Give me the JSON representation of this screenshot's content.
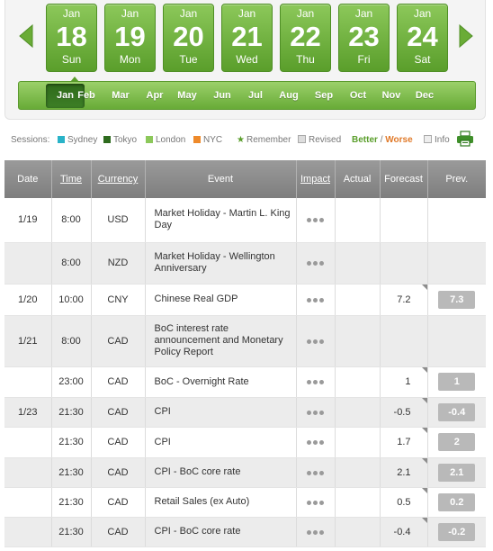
{
  "calendar": {
    "prev_label": "previous week",
    "next_label": "next week",
    "days": [
      {
        "month": "Jan",
        "day": "18",
        "weekday": "Sun"
      },
      {
        "month": "Jan",
        "day": "19",
        "weekday": "Mon"
      },
      {
        "month": "Jan",
        "day": "20",
        "weekday": "Tue"
      },
      {
        "month": "Jan",
        "day": "21",
        "weekday": "Wed"
      },
      {
        "month": "Jan",
        "day": "22",
        "weekday": "Thu"
      },
      {
        "month": "Jan",
        "day": "23",
        "weekday": "Fri"
      },
      {
        "month": "Jan",
        "day": "24",
        "weekday": "Sat"
      }
    ],
    "months": [
      "Jan",
      "Feb",
      "Mar",
      "Apr",
      "May",
      "Jun",
      "Jul",
      "Aug",
      "Sep",
      "Oct",
      "Nov",
      "Dec"
    ],
    "active_month": "Jan",
    "accent_color": "#6aac36"
  },
  "legend": {
    "sessions_label": "Sessions:",
    "sessions": [
      {
        "name": "Sydney",
        "color": "#29b3c8"
      },
      {
        "name": "Tokyo",
        "color": "#2e6b1e"
      },
      {
        "name": "London",
        "color": "#8cc85a"
      },
      {
        "name": "NYC",
        "color": "#ee8a2b"
      }
    ],
    "remember": "Remember",
    "revised": "Revised",
    "better": "Better",
    "separator": "/",
    "worse": "Worse",
    "info": "Info",
    "better_color": "#5a9e2b",
    "worse_color": "#e07a2a",
    "print_icon": "printer-icon"
  },
  "table": {
    "headers": {
      "date": "Date",
      "time": "Time",
      "currency": "Currency",
      "event": "Event",
      "impact": "Impact",
      "actual": "Actual",
      "forecast": "Forecast",
      "prev": "Prev."
    },
    "rows": [
      {
        "date": "1/19",
        "time": "8:00",
        "currency": "USD",
        "event": "Market Holiday - Martin L. King Day",
        "impact": "low",
        "actual": "",
        "forecast": "",
        "prev": "",
        "corner": false
      },
      {
        "date": "",
        "time": "8:00",
        "currency": "NZD",
        "event": "Market Holiday - Wellington Anniversary",
        "impact": "low",
        "actual": "",
        "forecast": "",
        "prev": "",
        "corner": false
      },
      {
        "date": "1/20",
        "time": "10:00",
        "currency": "CNY",
        "event": "Chinese Real GDP",
        "impact": "low",
        "actual": "",
        "forecast": "7.2",
        "prev": "7.3",
        "corner": true
      },
      {
        "date": "1/21",
        "time": "8:00",
        "currency": "CAD",
        "event": "BoC interest rate announcement and Monetary Policy Report",
        "impact": "low",
        "actual": "",
        "forecast": "",
        "prev": "",
        "corner": false
      },
      {
        "date": "",
        "time": "23:00",
        "currency": "CAD",
        "event": "BoC - Overnight Rate",
        "impact": "low",
        "actual": "",
        "forecast": "1",
        "prev": "1",
        "corner": true
      },
      {
        "date": "1/23",
        "time": "21:30",
        "currency": "CAD",
        "event": "CPI",
        "impact": "low",
        "actual": "",
        "forecast": "-0.5",
        "prev": "-0.4",
        "corner": true
      },
      {
        "date": "",
        "time": "21:30",
        "currency": "CAD",
        "event": "CPI",
        "impact": "low",
        "actual": "",
        "forecast": "1.7",
        "prev": "2",
        "corner": true
      },
      {
        "date": "",
        "time": "21:30",
        "currency": "CAD",
        "event": "CPI - BoC core rate",
        "impact": "low",
        "actual": "",
        "forecast": "2.1",
        "prev": "2.1",
        "corner": true
      },
      {
        "date": "",
        "time": "21:30",
        "currency": "CAD",
        "event": "Retail Sales (ex Auto)",
        "impact": "low",
        "actual": "",
        "forecast": "0.5",
        "prev": "0.2",
        "corner": true
      },
      {
        "date": "",
        "time": "21:30",
        "currency": "CAD",
        "event": "CPI - BoC core rate",
        "impact": "low",
        "actual": "",
        "forecast": "-0.4",
        "prev": "-0.2",
        "corner": true
      }
    ]
  }
}
